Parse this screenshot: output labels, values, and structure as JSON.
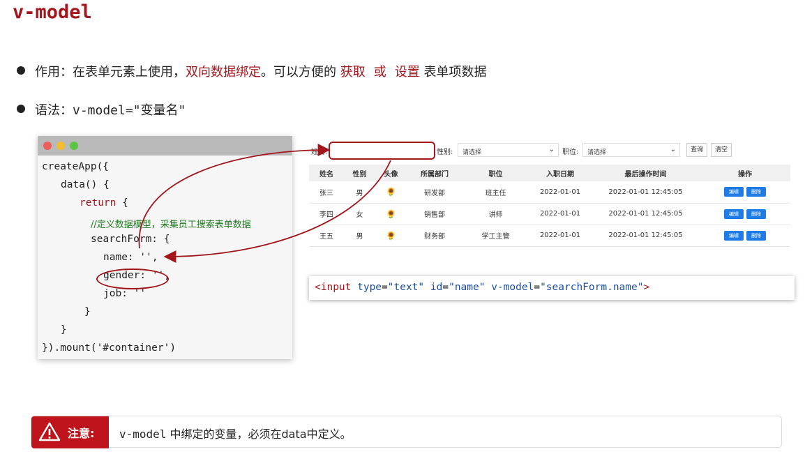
{
  "title": "v-model",
  "bullets": {
    "usage": {
      "prefix": "作用：在表单元素上使用，",
      "highlight1": "双向数据绑定",
      "middle": "。可以方便的 ",
      "get": "获取",
      "or": "或",
      "set": "设置",
      "suffix": " 表单项数据"
    },
    "syntax": {
      "prefix": "语法：",
      "code": "v-model=\"变量名\""
    }
  },
  "code": {
    "line1": "createApp({",
    "line2": "data() {",
    "line3_kw": "return",
    "line3_rest": " {",
    "comment": "//定义数据模型，采集员工搜索表单数据",
    "line5": "searchForm: {",
    "line6": "name: '',",
    "line7": "gender: '',",
    "line8": "job: ''",
    "line9": "}",
    "line10": "}",
    "line11": "}).mount('#container')"
  },
  "search": {
    "name_label": "姓名:",
    "gender_label": "性别:",
    "gender_value": "请选择",
    "job_label": "职位:",
    "job_value": "请选择",
    "query_button": "查询",
    "clear_button": "清空"
  },
  "table": {
    "headers": [
      "姓名",
      "性别",
      "头像",
      "所属部门",
      "职位",
      "入职日期",
      "最后操作时间",
      "操作"
    ],
    "rows": [
      {
        "name": "张三",
        "gender": "男",
        "avatar": "🌻",
        "dept": "研发部",
        "job": "班主任",
        "entry": "2022-01-01",
        "last_op": "2022-01-01 12:45:05"
      },
      {
        "name": "李四",
        "gender": "女",
        "avatar": "🌻",
        "dept": "销售部",
        "job": "讲师",
        "entry": "2022-01-01",
        "last_op": "2022-01-01 12:45:05"
      },
      {
        "name": "王五",
        "gender": "男",
        "avatar": "🌻",
        "dept": "财务部",
        "job": "学工主管",
        "entry": "2022-01-01",
        "last_op": "2022-01-01 12:45:05"
      }
    ],
    "edit_label": "编辑",
    "delete_label": "删除"
  },
  "input_snippet": {
    "open": "<input ",
    "type_attr": "type",
    "type_val": "\"text\"",
    "id_attr": "id",
    "id_val": "\"name\"",
    "model_attr": "v-model",
    "model_val": "\"searchForm.name\"",
    "close": ">"
  },
  "note": {
    "label": "注意:",
    "code": "v-model",
    "text": " 中绑定的变量，必须在data中定义。"
  },
  "colors": {
    "accent_red": "#a3161c",
    "comment_green": "#1e7a1e",
    "button_blue": "#1e7be8"
  }
}
